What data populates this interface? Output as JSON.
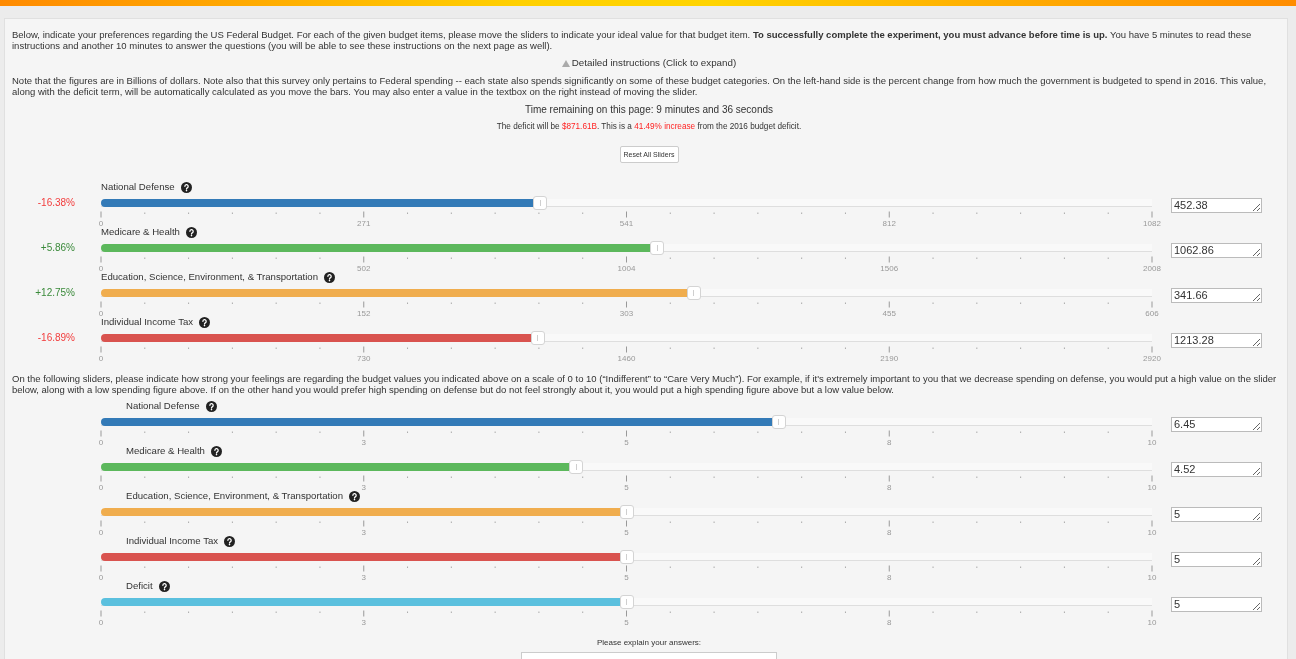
{
  "instructions": "Below, indicate your preferences regarding the US Federal Budget. For each of the given budget items, please move the sliders to indicate your ideal value for that budget item. **To successfully complete the experiment, you must advance before time is up.** You have 5 minutes to read these instructions and another 10 minutes to answer the questions (you will be able to see these instructions on the next page as well).",
  "details_toggle": {
    "label": "Detailed instructions (Click to expand)",
    "expanded": false
  },
  "note": "Note that the figures are in Billions of dollars. Note also that this survey only pertains to Federal spending -- each state also spends significantly on some of these budget categories. On the left-hand side is the percent change from how much the government is budgeted to spend in 2016. This value, along with the deficit term, will be automatically calculated as you move the bars. You may also enter a value in the textbox on the right instead of moving the slider.",
  "timer": "Time remaining on this page: 9 minutes and 36 seconds",
  "deficit_summary": [
    {
      "text": "The deficit will be ",
      "highlight": false
    },
    {
      "text": "$871.61B",
      "highlight": true
    },
    {
      "text": ". This is a ",
      "highlight": false
    },
    {
      "text": "41.49% increase",
      "highlight": true
    },
    {
      "text": " from the 2016 budget deficit.",
      "highlight": false
    }
  ],
  "reset_button": "Reset All Sliders",
  "budget_sliders": [
    {
      "label": "National Defense",
      "change": "-16.38%",
      "decrease": true,
      "color": "#337ab7",
      "level": 0.4181,
      "ticks": [
        "0",
        "271",
        "541",
        "812",
        "1082"
      ],
      "value": "452.38"
    },
    {
      "label": "Medicare & Health",
      "change": "+5.86%",
      "decrease": false,
      "color": "#5cb85c",
      "level": 0.5293,
      "ticks": [
        "0",
        "502",
        "1004",
        "1506",
        "2008"
      ],
      "value": "1062.86"
    },
    {
      "label": "Education, Science, Environment, & Transportation",
      "change": "+12.75%",
      "decrease": false,
      "color": "#f0ad4e",
      "level": 0.5638,
      "ticks": [
        "0",
        "152",
        "303",
        "455",
        "606"
      ],
      "value": "341.66"
    },
    {
      "label": "Individual Income Tax",
      "change": "-16.89%",
      "decrease": true,
      "color": "#d9534f",
      "level": 0.4155,
      "ticks": [
        "0",
        "730",
        "1460",
        "2190",
        "2920"
      ],
      "value": "1213.28"
    }
  ],
  "importance_intro": "On the following sliders, please indicate how strong your feelings are regarding the budget values you indicated above on a scale of 0 to 10 (“Indifferent” to “Care Very Much”). For example, if it's extremely important to you that we decrease spending on defense, you would put a high value on the slider below, along with a low spending figure above. If on the other hand you would prefer high spending on defense but do not feel strongly about it, you would put a high spending figure above but a low value below.",
  "importance_sliders": [
    {
      "label": "National Defense",
      "color": "#337ab7",
      "level": 0.645,
      "ticks": [
        "0",
        "3",
        "5",
        "8",
        "10"
      ],
      "value": "6.45"
    },
    {
      "label": "Medicare & Health",
      "color": "#5cb85c",
      "level": 0.452,
      "ticks": [
        "0",
        "3",
        "5",
        "8",
        "10"
      ],
      "value": "4.52"
    },
    {
      "label": "Education, Science, Environment, & Transportation",
      "color": "#f0ad4e",
      "level": 0.5,
      "ticks": [
        "0",
        "3",
        "5",
        "8",
        "10"
      ],
      "value": "5"
    },
    {
      "label": "Individual Income Tax",
      "color": "#d9534f",
      "level": 0.5,
      "ticks": [
        "0",
        "3",
        "5",
        "8",
        "10"
      ],
      "value": "5"
    },
    {
      "label": "Deficit",
      "color": "#5bc0de",
      "level": 0.5,
      "ticks": [
        "0",
        "3",
        "5",
        "8",
        "10"
      ],
      "value": "5"
    }
  ],
  "explanation": {
    "label": "Please explain your answers:"
  }
}
